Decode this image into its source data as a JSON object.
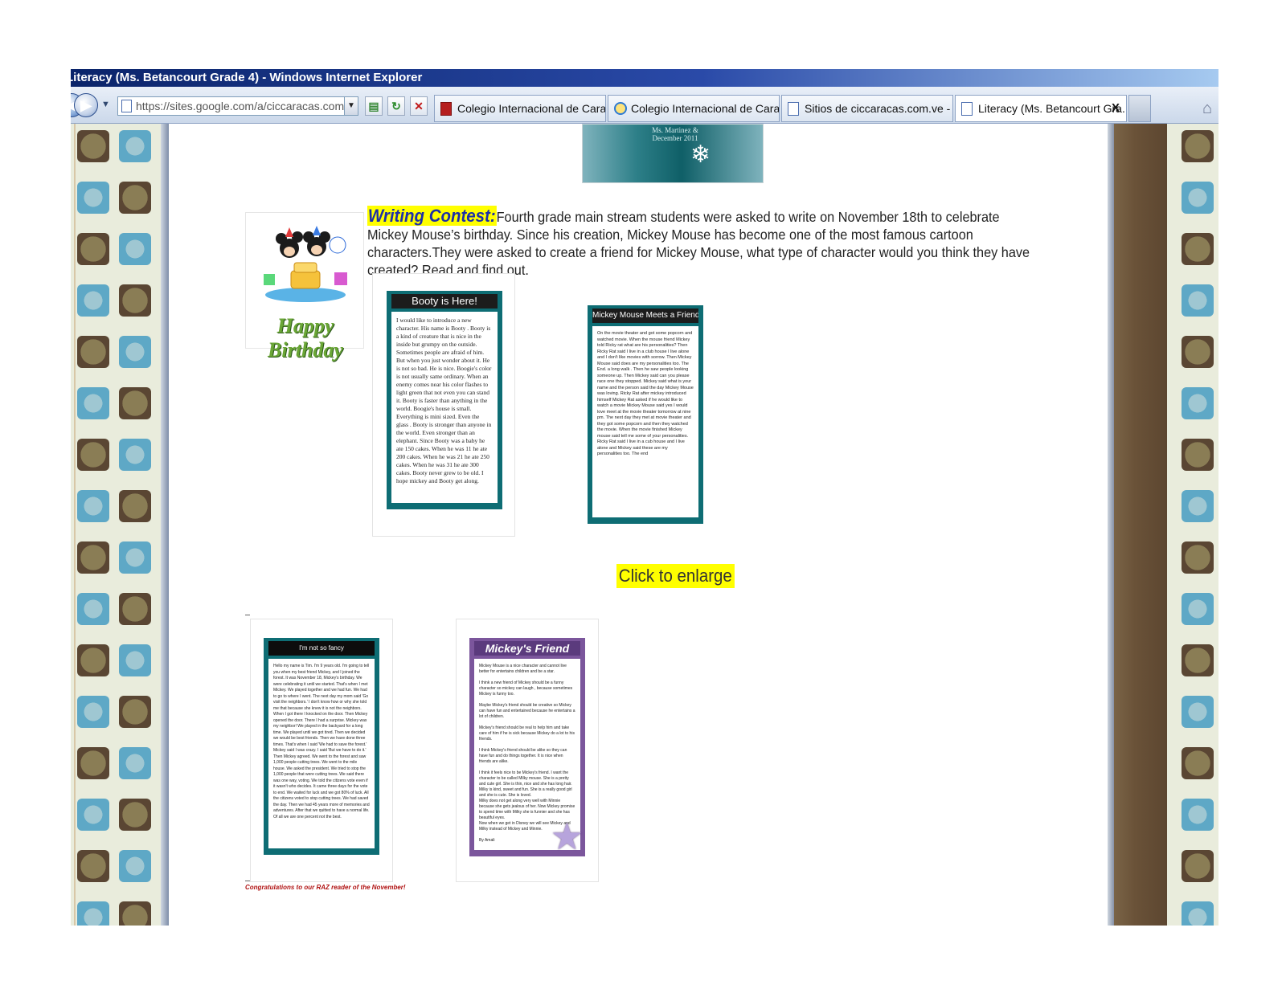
{
  "window": {
    "title": "Literacy (Ms. Betancourt Grade 4) - Windows Internet Explorer"
  },
  "toolbar": {
    "back_glyph": "◀",
    "forward_glyph": "▶",
    "dropdown_glyph": "▼",
    "address": "https://sites.google.com/a/ciccaracas.com.ve",
    "search_glyph": "⌕",
    "addr_drop_glyph": "▼",
    "compat_glyph": "▤",
    "refresh_glyph": "↻",
    "stop_glyph": "✕"
  },
  "tabs": [
    {
      "label": "Colegio Internacional de Caracas",
      "icon": "red-page-icon"
    },
    {
      "label": "Colegio Internacional de Caraca...",
      "icon": "ie-icon"
    },
    {
      "label": "Sitios de ciccaracas.com.ve - Go...",
      "icon": "page-icon"
    },
    {
      "label": "Literacy (Ms. Betancourt Gra...",
      "icon": "page-icon",
      "close_glyph": "X"
    }
  ],
  "home_glyph": "⌂",
  "banner": {
    "text": "Ms. Martinez &\nDecember 2011",
    "snow_glyph": "❄"
  },
  "birthday": {
    "text": "Happy Birthday"
  },
  "intro": {
    "label": "Writing Contest:",
    "text": "Fourth grade main stream students were asked to write on  November 18th  to celebrate Mickey Mouse’s  birthday. Since his creation, Mickey Mouse has become one of the most famous cartoon characters.They were asked to create a friend for Mickey Mouse, what type of character would you think they have created? Read and find out."
  },
  "cards": [
    {
      "title": "Booty is Here!",
      "body": "I would like to introduce a new character. His name is Booty . Booty is a kind of creature that is nice in the inside  but grumpy on the outside. Sometimes people are afraid of him. But when you just wonder about it. He is not so bad. He is nice. Boogie's color is not usually same ordinary. When an enemy comes near his color flashes to light green that not even you can stand it. Booty is faster than anything in the world. Boogie's house is small. Everything is mini sized. Even the glass  .  Booty is stronger than anyone in the world. Even stronger than an elephant. Since Booty was a baby he ate 150 cakes. When he was 11 he ate 200 cakes. When he was 21 he ate 250 cakes. When he was 31 he ate 300 cakes. Booty never grew to be old. I hope mickey  and Booty get along."
    },
    {
      "title": "Mickey Mouse Meets a Friend",
      "body": "On the movie theater and got some popcorn and watched movie. When the mouse friend Mickey told Ricky rat what are his personalities? Then Ricky Rat said I live in a club house I live alone and I don't like movies with sorrow. Then Mickey Mouse said does are my personalities too. The End. a long walk . Then he saw people looking someone up. Then Mickey said can you please race one they stopped. Mickey said what is your name and the person said the day Mickey Mouse was loving. Ricky Rat after mickey introduced himself Mickey Rat asked if he would like to watch a movie Mickey Mouse said yes I would love meet at the movie theater tomorrow at nine pm. The next day they met at movie theater and they got some popcorn and then they watched the movie. When the movie finished Mickey mouse said tell me some of your personalities. Ricky Rat said I live in a cub house and I live alone and Mickey said these are my personalities too. The end"
    },
    {
      "title": "I'm not so fancy",
      "body": "Hello my name is Tim. I'm 9 years old. I'm going to tell you when my best friend Mickey, and I joined the forest. It was November 18, Mickey's birthday. We were celebrating it until we started. That's when I met Mickey. We played together and we had fun. We had to go to where I went. The next day my mom said 'Go visit the neighbors.' I don't know how or why she told me that because she knew it is not the neighbors. When I got there I knocked on the door. Then Mickey opened the door. There I had a surprise. Mickey was my neighbor! We played in the backyard for a long time. We played until we got tired. Then we decided we would be best friends. Then we have done three times. That's when I said 'We had to save the forest.' Mickey said I was crazy. I said 'But we have to do it.' Then Mickey agreed. We went to the forest and saw 1,000 people cutting trees. We went to the mile house. We asked the president. We tried to stop the 1,000 people that were cutting trees. We said there was one way, voting. We told the citizens vote even if it wasn't who decides. It came three days for the vote to end. We waited for luck and we got 80% of luck. All the citizens voted to stop cutting trees. We had saved the day. Then we had 45 years more of memories and adventures. After that we quitted to have a normal life. Of all we are one percent not the best."
    },
    {
      "title": "Mickey's Friend",
      "body": "Mickey Mouse is a nice character and cannot live better for entertains children and be a star.\n\nI think a new friend of Mickey should be a funny character so mickey can laugh , because sometimes Mickey is funny too.\n\nMaybe Mickey's friend should be creative so Mickey can have fun and entertained because he entertains a lot of children.\n\nMickey's friend should be real to help him and take care of him if he is sick because Mickey do a lot to his friends.\n\nI think Mickey's friend should be alike so they can have fun and do things together. It is nice when friends are alike.\n\nI think it feels nice to be Mickey's friend. I want the character to be called Milky mouse. She is a pretty and cute girl. She is thin, nice and she has long hair. Milky is kind, sweet and fun. She is a really good girl and she is cute. She is loved.\nMilky does not get along very well with Minnie because she gets jealous of her. Now Mickey promise to spend time with Milky she is funnier and she has beautiful eyes.\nNow when we get in Disney we will see Mickey and Milky instead of Mickey and Minnie.\n\nBy Amali"
    }
  ],
  "star_glyph": "★",
  "enlarge": "Click to enlarge",
  "congrats": "Congratulations to our RAZ reader of the November!"
}
